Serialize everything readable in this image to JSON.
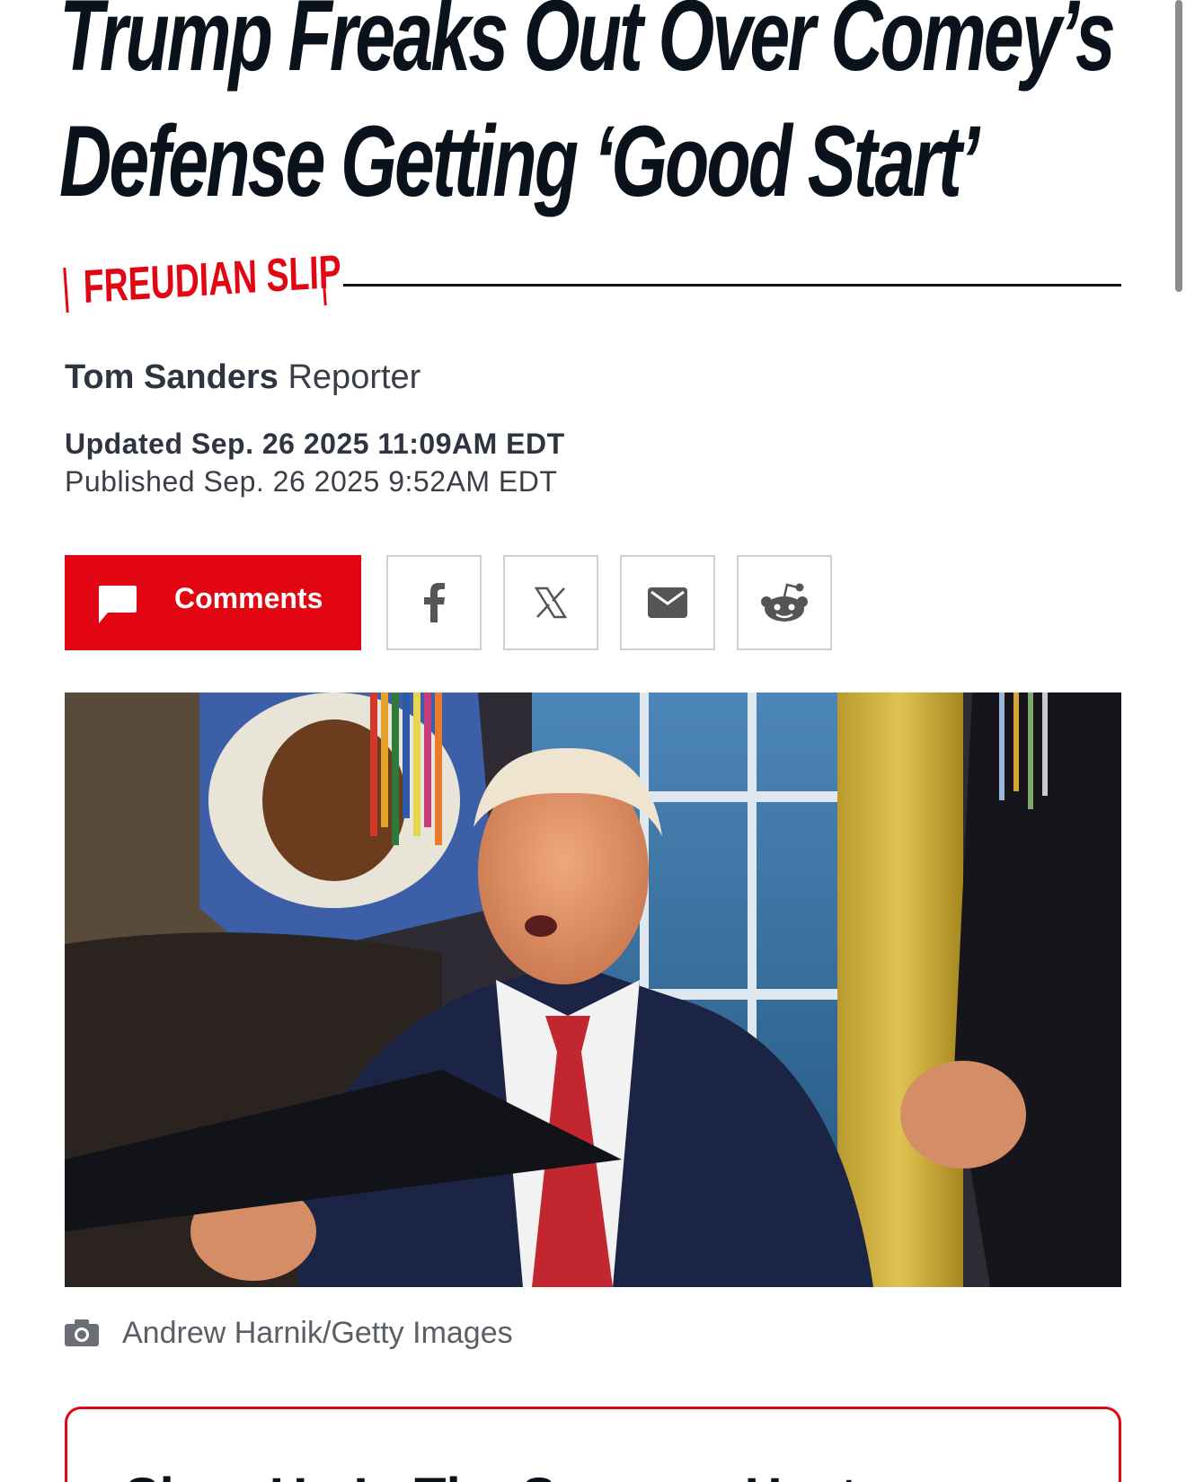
{
  "article": {
    "headline_line1": "Trump Freaks Out Over Comey’s",
    "headline_line2": "Defense Getting ‘Good Start’",
    "kicker": "FREUDIAN SLIP",
    "author": "Tom Sanders",
    "author_role": "Reporter",
    "updated": "Updated Sep. 26 2025 11:09AM EDT",
    "published": "Published Sep. 26 2025 9:52AM EDT"
  },
  "share": {
    "comments_label": "Comments",
    "buttons": [
      {
        "icon": "facebook-icon"
      },
      {
        "icon": "x-icon"
      },
      {
        "icon": "email-icon"
      },
      {
        "icon": "reddit-icon"
      }
    ]
  },
  "photo": {
    "credit": "Andrew Harnik/Getty Images"
  },
  "promo": {
    "title": "Shop Up In The Summer Heat"
  },
  "colors": {
    "accent": "#e20613",
    "headline": "#0a121c",
    "meta": "#2e3540"
  }
}
